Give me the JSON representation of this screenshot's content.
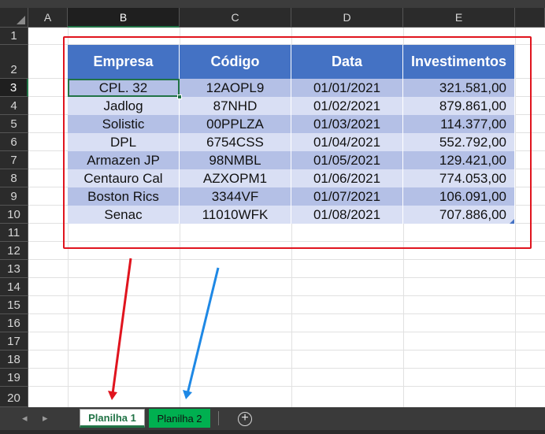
{
  "columns": [
    "A",
    "B",
    "C",
    "D",
    "E"
  ],
  "rows": [
    "1",
    "2",
    "3",
    "4",
    "5",
    "6",
    "7",
    "8",
    "9",
    "10",
    "11",
    "12",
    "13",
    "14",
    "15",
    "16",
    "17",
    "18",
    "19",
    "20"
  ],
  "table": {
    "headers": [
      "Empresa",
      "Código",
      "Data",
      "Investimentos"
    ],
    "rows": [
      [
        "CPL. 32",
        "12AOPL9",
        "01/01/2021",
        "321.581,00"
      ],
      [
        "Jadlog",
        "87NHD",
        "01/02/2021",
        "879.861,00"
      ],
      [
        "Solistic",
        "00PPLZA",
        "01/03/2021",
        "114.377,00"
      ],
      [
        "DPL",
        "6754CSS",
        "01/04/2021",
        "552.792,00"
      ],
      [
        "Armazen JP",
        "98NMBL",
        "01/05/2021",
        "129.421,00"
      ],
      [
        "Centauro Cal",
        "AZXOPM1",
        "01/06/2021",
        "774.053,00"
      ],
      [
        "Boston Rics",
        "3344VF",
        "01/07/2021",
        "106.091,00"
      ],
      [
        "Senac",
        "11010WFK",
        "01/08/2021",
        "707.886,00"
      ]
    ]
  },
  "sheet_tabs": {
    "tab1": "Planilha 1",
    "tab2": "Planilha 2",
    "add_icon": "plus-circle-icon",
    "add_symbol": "+"
  },
  "colors": {
    "header_blue": "#4472c4",
    "band_dark": "#b4c0e6",
    "band_light": "#d9dff4",
    "highlight_box": "#e0141e",
    "arrow_red": "#e0141e",
    "arrow_blue": "#1e88e5",
    "tab2_green": "#00b050"
  }
}
